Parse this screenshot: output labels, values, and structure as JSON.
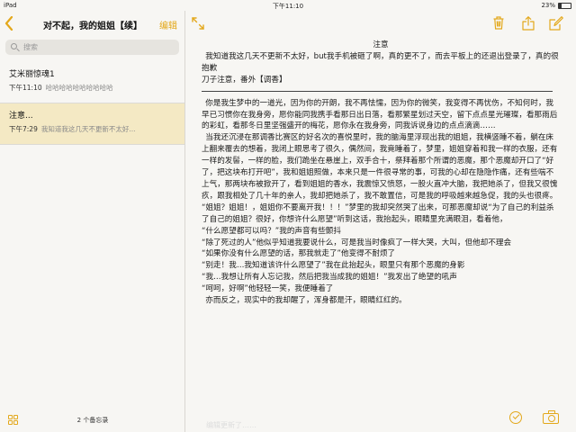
{
  "status_bar": {
    "carrier": "iPad",
    "time": "下午11:10",
    "battery": "23%",
    "battery_level": 0.23
  },
  "colors": {
    "accent": "#e3a81b",
    "selected_row": "#f4e9c4"
  },
  "sidebar": {
    "title": "对不起，我的姐姐【续】",
    "edit_label": "编辑",
    "search_placeholder": "搜索",
    "notes": [
      {
        "title": "艾米丽惊魂1",
        "time": "下午11:10",
        "preview": "哈哈哈哈哈哈哈哈哈哈"
      },
      {
        "title": "注意...",
        "time": "下午7:29",
        "preview": "我知道我这几天不更新不太好..."
      }
    ],
    "count_label": "2 个备忘录"
  },
  "icons": {
    "back": "chevron-left-icon",
    "expand": "expand-icon",
    "trash": "trash-icon",
    "share": "share-icon",
    "compose": "compose-icon",
    "check": "checkmark-icon",
    "camera": "camera-icon",
    "grid": "grid-icon"
  },
  "note": {
    "heading": "注意",
    "notice_1": "我知道我这几天不更新不太好，but我手机被砸了啊，真的更不了，而去平板上的还退出登录了，真的很抱歉",
    "notice_2": "刀子注意，番外【调香】",
    "paragraphs": [
      "你是我生梦中的一道光，因为你的开朗，我不再怯懦，因为你的微笑，我变得不再忧伤，不知何时，我早已习惯你在我身旁，愿你能同我携手看那日出日落，看那繁星划过天空，留下点点星光璀璨，看那雨后的彩虹，看那冬日里坚强盛开的梅花，愿你永在我身旁，同我诉说身边的点点滴滴……",
      "当我还沉浸在那调香比赛区的好名次的喜悦里时，我的脑海里浮现出我的姐姐，我横竖睡不着，躺在床上翻来覆去的想着，我闭上眼思考了很久，偶然间，我竟睡着了，梦里，姐姐穿着和我一样的衣服，还有一样的发髻，一样的脸，我们跪坐在悬崖上，双手合十，祭拜着那个所谓的恶魔，那个恶魔却开口了“好了，把这块布打开吧”，我和姐姐照做，本来只是一件很寻常的事，可我的心却在隐隐作痛，还有些喘不上气，那两块布被掀开了，看到姐姐的香水，我震惊又愤怒，一股火直冲大脑，我把她杀了，但我又很愧疚，跟我相处了几十年的亲人，我却把她杀了，我不敢置信，可是我的呼吸越来越急促，我的头也很疼。",
      "“姐姐？姐姐！，姐姐你不要离开我！！！”梦里的我却突然哭了出来，可那恶魔却说“为了自己的利益杀了自己的姐姐？很好，你想许什么愿望”听到这话，我抬起头，眼睛里充满眼泪，看着他，",
      "“什么愿望都可以吗？”我的声音有些颤抖",
      "“除了死过的人”他似乎知道我要说什么，可是我当时像疯了一样大哭，大叫，但他却不理会",
      "“如果你没有什么愿望的话，那我就走了”他变得不耐烦了",
      "“别走！我…我知道该许什么愿望了”我在此抬起头，眼里只有那个恶魔的身影",
      "“我…我想让所有人忘记我，然后把我当成我的姐姐！”我发出了绝望的吼声",
      "“呵呵，好啊”他轻轻一笑，我便睡着了",
      "亦而反之，现实中的我却醒了，浑身都是汗，眼睛红红的。"
    ],
    "ghost_text": "编辑更新了……"
  }
}
